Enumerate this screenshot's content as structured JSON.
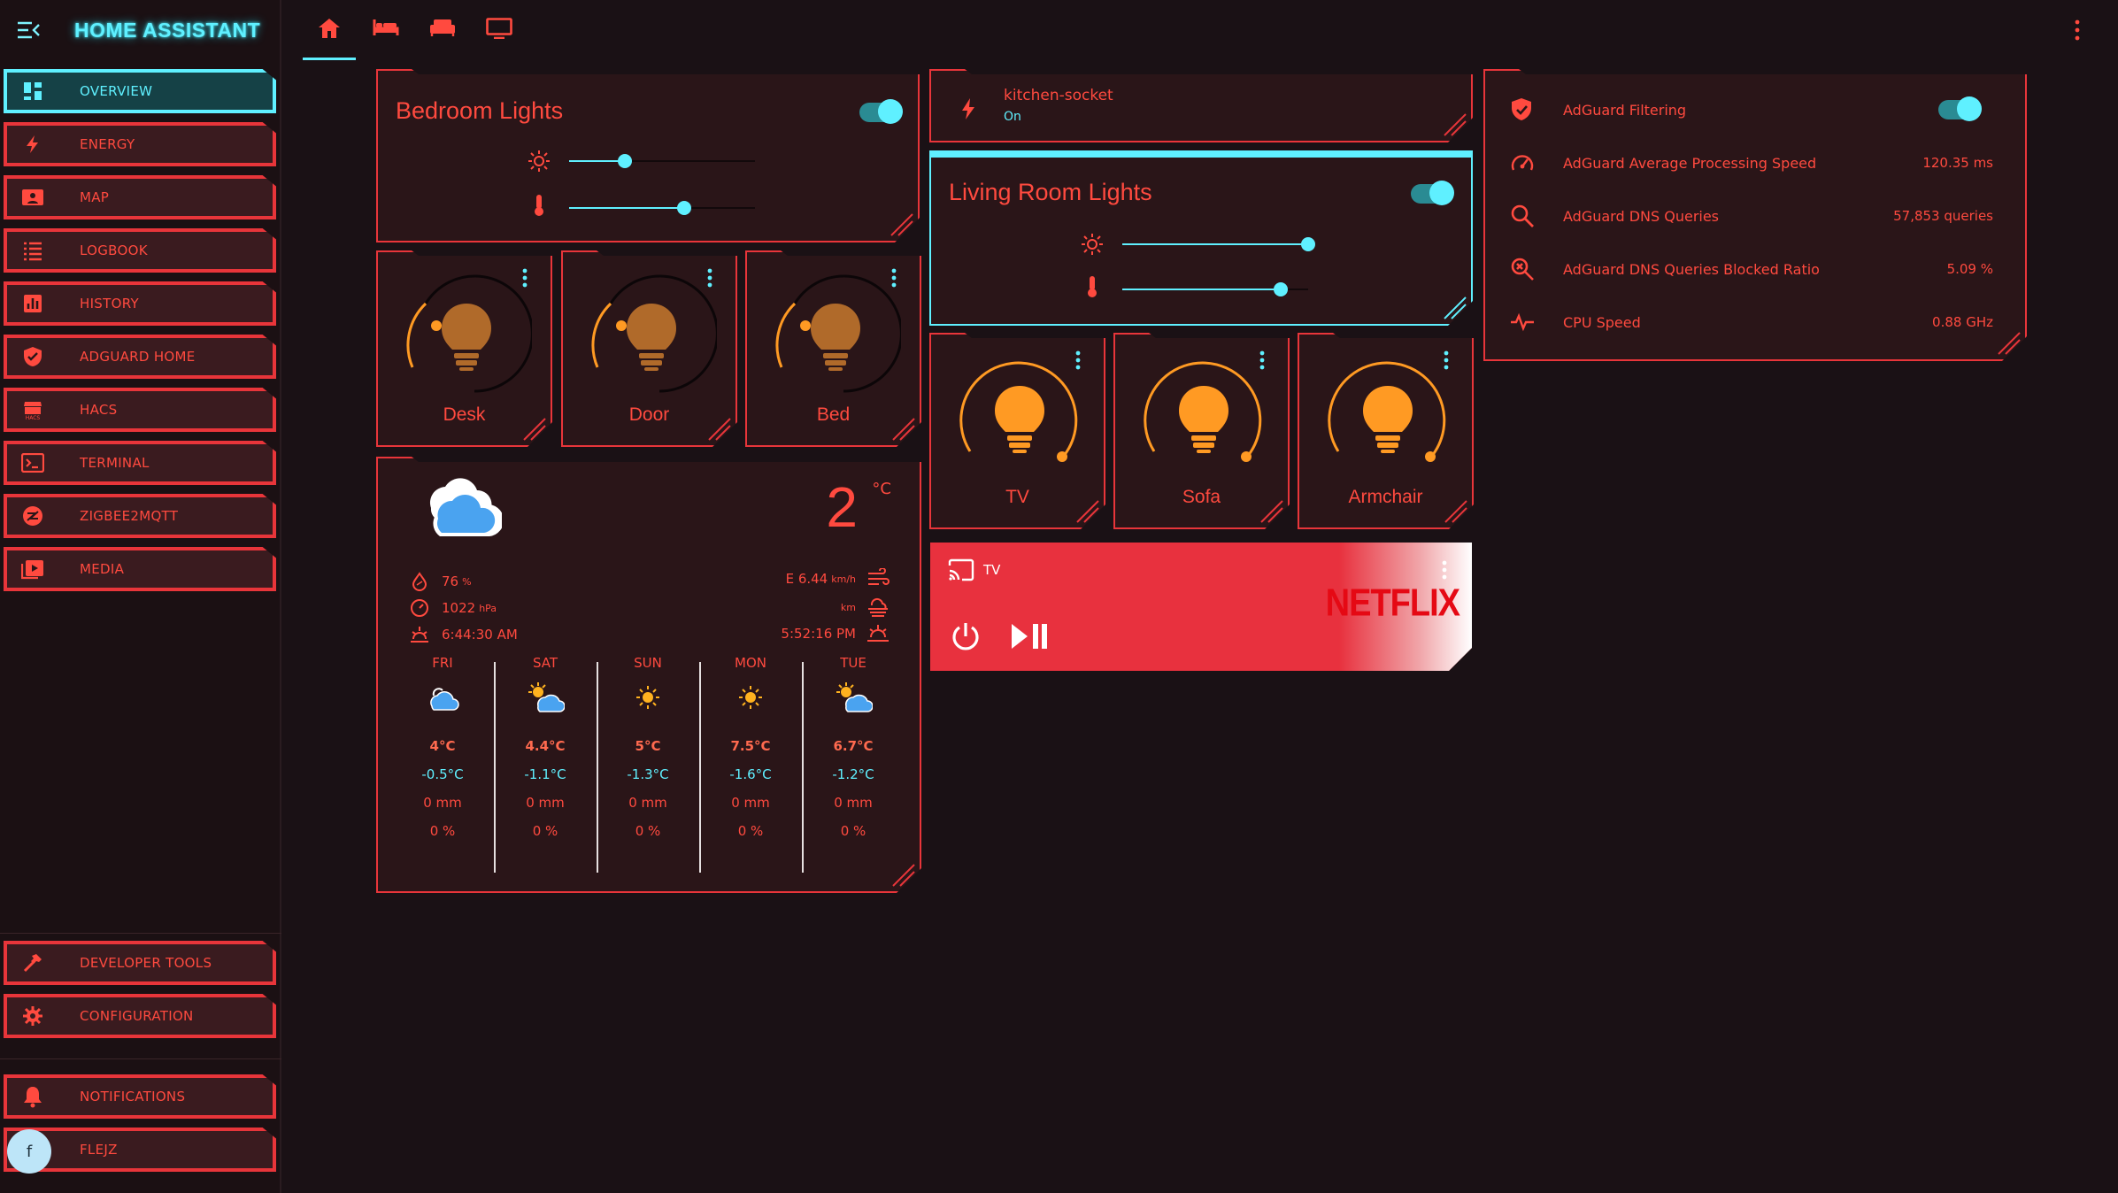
{
  "app": {
    "title": "HOME ASSISTANT"
  },
  "sidebar": {
    "items": [
      {
        "label": "OVERVIEW",
        "icon": "overview-icon",
        "active": true
      },
      {
        "label": "ENERGY",
        "icon": "lightning-icon"
      },
      {
        "label": "MAP",
        "icon": "map-icon"
      },
      {
        "label": "LOGBOOK",
        "icon": "logbook-icon"
      },
      {
        "label": "HISTORY",
        "icon": "history-icon"
      },
      {
        "label": "ADGUARD HOME",
        "icon": "shield-icon"
      },
      {
        "label": "HACS",
        "icon": "hacs-icon"
      },
      {
        "label": "TERMINAL",
        "icon": "terminal-icon"
      },
      {
        "label": "ZIGBEE2MQTT",
        "icon": "zigbee-icon"
      },
      {
        "label": "MEDIA",
        "icon": "media-icon"
      }
    ],
    "bottom_items": [
      {
        "label": "DEVELOPER TOOLS",
        "icon": "hammer-icon"
      },
      {
        "label": "CONFIGURATION",
        "icon": "gear-icon"
      }
    ],
    "notifications_label": "NOTIFICATIONS",
    "user_label": "FLEJZ",
    "user_initial": "f"
  },
  "tabs": [
    "home-icon",
    "bed-icon",
    "sofa-icon",
    "tv-icon"
  ],
  "bedroom": {
    "title": "Bedroom Lights",
    "on": true,
    "brightness": 0.3,
    "color_temp": 0.62,
    "lights": [
      {
        "name": "Desk",
        "brightness": 0.0
      },
      {
        "name": "Door",
        "brightness": 0.0
      },
      {
        "name": "Bed",
        "brightness": 0.0
      }
    ]
  },
  "socket": {
    "name": "kitchen-socket",
    "state": "On"
  },
  "living": {
    "title": "Living Room Lights",
    "on": true,
    "brightness": 1.0,
    "color_temp": 0.85,
    "lights": [
      {
        "name": "TV",
        "brightness": 1.0
      },
      {
        "name": "Sofa",
        "brightness": 1.0
      },
      {
        "name": "Armchair",
        "brightness": 1.0
      }
    ]
  },
  "weather": {
    "temp": "2",
    "unit": "°C",
    "humidity": "76",
    "humidity_unit": "%",
    "pressure": "1022",
    "pressure_unit": "hPa",
    "sunrise": "6:44:30 AM",
    "wind": "E 6.44",
    "wind_unit": "km/h",
    "visibility_unit": "km",
    "sunset": "5:52:16 PM",
    "forecast": [
      {
        "day": "FRI",
        "icon": "cloud-icon",
        "hi": "4°C",
        "lo": "-0.5°C",
        "precip": "0 mm",
        "pct": "0 %"
      },
      {
        "day": "SAT",
        "icon": "partly-cloudy-icon",
        "hi": "4.4°C",
        "lo": "-1.1°C",
        "precip": "0 mm",
        "pct": "0 %"
      },
      {
        "day": "SUN",
        "icon": "sun-icon",
        "hi": "5°C",
        "lo": "-1.3°C",
        "precip": "0 mm",
        "pct": "0 %"
      },
      {
        "day": "MON",
        "icon": "sun-icon",
        "hi": "7.5°C",
        "lo": "-1.6°C",
        "precip": "0 mm",
        "pct": "0 %"
      },
      {
        "day": "TUE",
        "icon": "partly-cloudy-icon",
        "hi": "6.7°C",
        "lo": "-1.2°C",
        "precip": "0 mm",
        "pct": "0 %"
      }
    ]
  },
  "media": {
    "name": "TV",
    "logo": "NETFLIX"
  },
  "adguard": {
    "filtering_label": "AdGuard Filtering",
    "filtering_on": true,
    "rows": [
      {
        "label": "AdGuard Average Processing Speed",
        "value": "120.35 ms",
        "icon": "speedometer-icon"
      },
      {
        "label": "AdGuard DNS Queries",
        "value": "57,853 queries",
        "icon": "search-icon"
      },
      {
        "label": "AdGuard DNS Queries Blocked Ratio",
        "value": "5.09 %",
        "icon": "search-blocked-icon"
      },
      {
        "label": "CPU Speed",
        "value": "0.88 GHz",
        "icon": "pulse-icon"
      }
    ]
  },
  "colors": {
    "accent": "#ff4a3f",
    "cyan": "#5ff0ff",
    "bulb_on": "#ff9a23",
    "bulb_off": "#b06a2a",
    "media_bg": "#e8313e"
  }
}
